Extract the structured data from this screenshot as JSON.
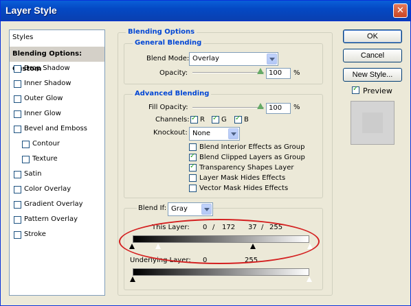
{
  "window": {
    "title": "Layer Style",
    "close_glyph": "✕"
  },
  "styles_list": {
    "header": "Styles",
    "selected": "Blending Options: Custom",
    "items": [
      {
        "label": "Drop Shadow",
        "checked": false
      },
      {
        "label": "Inner Shadow",
        "checked": false
      },
      {
        "label": "Outer Glow",
        "checked": false
      },
      {
        "label": "Inner Glow",
        "checked": false
      },
      {
        "label": "Bevel and Emboss",
        "checked": false
      },
      {
        "label": "Contour",
        "checked": false
      },
      {
        "label": "Texture",
        "checked": false
      },
      {
        "label": "Satin",
        "checked": false
      },
      {
        "label": "Color Overlay",
        "checked": false
      },
      {
        "label": "Gradient Overlay",
        "checked": false
      },
      {
        "label": "Pattern Overlay",
        "checked": false
      },
      {
        "label": "Stroke",
        "checked": false
      }
    ]
  },
  "blending_options": {
    "title": "Blending Options",
    "general": {
      "title": "General Blending",
      "blend_mode_label": "Blend Mode:",
      "blend_mode_value": "Overlay",
      "opacity_label": "Opacity:",
      "opacity_value": "100",
      "opacity_unit": "%",
      "opacity_level": 1.0
    },
    "advanced": {
      "title": "Advanced Blending",
      "fill_opacity_label": "Fill Opacity:",
      "fill_opacity_value": "100",
      "fill_opacity_unit": "%",
      "fill_opacity_level": 1.0,
      "channels_label": "Channels:",
      "channels": [
        {
          "label": "R",
          "checked": true
        },
        {
          "label": "G",
          "checked": true
        },
        {
          "label": "B",
          "checked": true
        }
      ],
      "knockout_label": "Knockout:",
      "knockout_value": "None",
      "options": [
        {
          "label": "Blend Interior Effects as Group",
          "checked": false
        },
        {
          "label": "Blend Clipped Layers as Group",
          "checked": true
        },
        {
          "label": "Transparency Shapes Layer",
          "checked": true
        },
        {
          "label": "Layer Mask Hides Effects",
          "checked": false
        },
        {
          "label": "Vector Mask Hides Effects",
          "checked": false
        }
      ]
    },
    "blend_if": {
      "label": "Blend If:",
      "value": "Gray",
      "this_layer_label": "This Layer:",
      "this_layer_low": "0",
      "this_layer_low_split": "172",
      "this_layer_high_split": "37",
      "this_layer_high": "255",
      "separator": "/",
      "underlying_label": "Underlying Layer:",
      "underlying_low": "0",
      "underlying_high": "255"
    }
  },
  "buttons": {
    "ok": "OK",
    "cancel": "Cancel",
    "new_style": "New Style...",
    "preview_label": "Preview",
    "preview_checked": true
  },
  "colors": {
    "accent_blue": "#0046d5",
    "highlight_ellipse": "#d42020"
  }
}
